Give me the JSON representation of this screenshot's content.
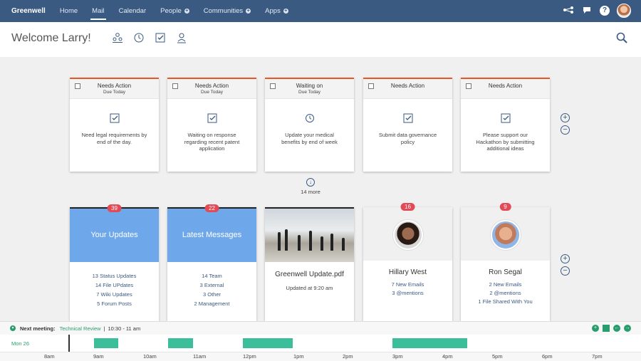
{
  "nav": {
    "brand": "Greenwell",
    "items": [
      {
        "label": "Home",
        "plus": false
      },
      {
        "label": "Mail",
        "plus": false,
        "active": true
      },
      {
        "label": "Calendar",
        "plus": false
      },
      {
        "label": "People",
        "plus": true
      },
      {
        "label": "Communities",
        "plus": true
      },
      {
        "label": "Apps",
        "plus": true
      }
    ],
    "help": "?"
  },
  "header": {
    "welcome": "Welcome Larry!"
  },
  "actions": [
    {
      "status": "Needs Action",
      "due": "Due Today",
      "icon": "check-icon",
      "desc": "Need legal requirements by end of the day."
    },
    {
      "status": "Needs Action",
      "due": "Due Today",
      "icon": "check-icon",
      "desc": "Waiting on response regarding recent patent application"
    },
    {
      "status": "Waiting on",
      "due": "Due Today",
      "icon": "clock-icon",
      "desc": "Update your medical benefits by end of week"
    },
    {
      "status": "Needs Action",
      "due": "",
      "icon": "check-icon",
      "desc": "Submit data governance policy"
    },
    {
      "status": "Needs Action",
      "due": "",
      "icon": "check-icon",
      "desc": "Please support our Hackathon by submitting additional ideas"
    }
  ],
  "more": {
    "label": "14 more"
  },
  "updates": {
    "badge": "39",
    "title": "Your Updates",
    "items": [
      "13 Status Updates",
      "14 File UPdates",
      "7 Wiki Updates",
      "5 Forum Posts"
    ]
  },
  "messages": {
    "badge": "22",
    "title": "Latest Messages",
    "items": [
      "14 Team",
      "3 External",
      "3 Other",
      "2 Management"
    ]
  },
  "document": {
    "title": "Greenwell Update.pdf",
    "sub": "Updated at 9:20 am"
  },
  "people": [
    {
      "badge": "16",
      "name": "Hillary West",
      "items": [
        "7 New Emails",
        "3 @mentions"
      ]
    },
    {
      "badge": "9",
      "name": "Ron Segal",
      "items": [
        "2 New Emails",
        "2 @mentions",
        "1 File Shared With You"
      ]
    }
  ],
  "meeting": {
    "label": "Next meeting:",
    "title": "Technical Review",
    "sep": "|",
    "time": "10:30 - 11 am"
  },
  "timeline": {
    "day": "Mon 26",
    "hours": [
      "8am",
      "9am",
      "10am",
      "11am",
      "12pm",
      "1pm",
      "2pm",
      "3pm",
      "4pm",
      "5pm",
      "6pm",
      "7pm"
    ]
  },
  "colors": {
    "nav": "#3a5a82",
    "accent": "#e35a2a",
    "blue": "#6fa8ea",
    "green": "#3bbf9a",
    "badge": "#e24a55"
  }
}
